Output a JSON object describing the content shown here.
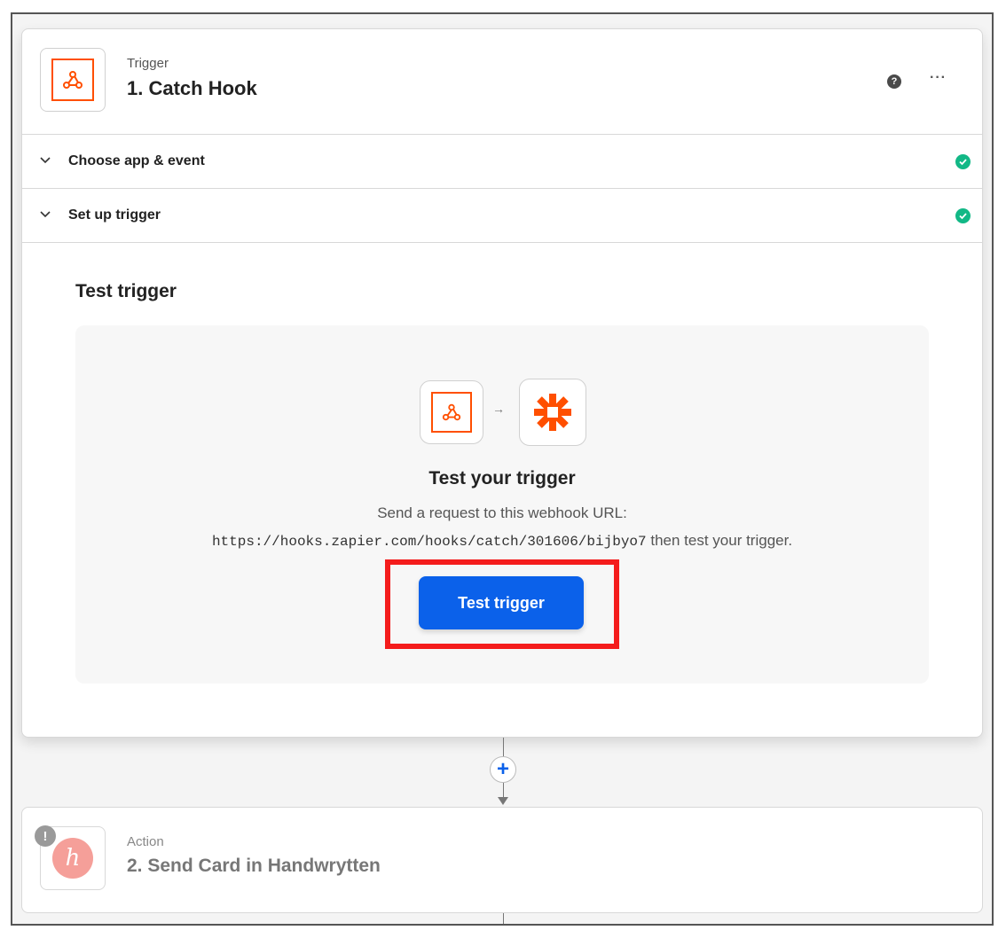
{
  "trigger_step": {
    "app_icon": "webhook-icon",
    "type_label": "Trigger",
    "title": "1. Catch Hook",
    "help_icon": "question-icon",
    "more_icon": "ellipsis-icon",
    "more_label": "···"
  },
  "sections": [
    {
      "label": "Choose app & event",
      "status": "complete"
    },
    {
      "label": "Set up trigger",
      "status": "complete"
    }
  ],
  "test": {
    "section_title": "Test trigger",
    "flow_arrow": "→",
    "heading": "Test your trigger",
    "line1": "Send a request to this webhook URL:",
    "webhook_url": "https://hooks.zapier.com/hooks/catch/301606/bijbyo7",
    "line2_suffix": " then test your trigger.",
    "button_label": "Test trigger"
  },
  "add_step": {
    "label": "+"
  },
  "action_step": {
    "type_label": "Action",
    "title": "2. Send Card in Handwrytten",
    "app_icon": "handwrytten-logo",
    "logo_letter": "h",
    "warning_label": "!"
  },
  "colors": {
    "accent": "#0b61ea",
    "brand_orange": "#ff4f00",
    "success": "#12b886",
    "highlight": "#f41c1c"
  }
}
